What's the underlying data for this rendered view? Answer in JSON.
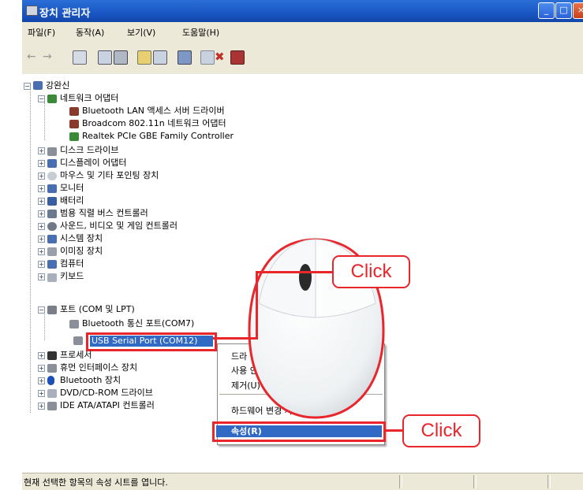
{
  "window": {
    "title": "장치 관리자",
    "controls": [
      "minimize",
      "maximize",
      "close"
    ]
  },
  "menu": [
    "파일(F)",
    "동작(A)",
    "보기(V)",
    "도움말(H)"
  ],
  "toolbar": {
    "icons": [
      "back-icon",
      "forward-icon",
      "view-icon",
      "properties-icon",
      "print-icon",
      "help-icon",
      "scan-icon",
      "update-driver-icon",
      "disable-icon",
      "uninstall-icon",
      "stop-icon"
    ]
  },
  "tree": {
    "root": "강완신",
    "network": {
      "label": "네트워크 어댑터",
      "children": [
        "Bluetooth LAN 액세스 서버 드라이버",
        "Broadcom 802.11n 네트워크 어댑터",
        "Realtek PCIe GBE Family Controller"
      ]
    },
    "categories_a": [
      "디스크 드라이브",
      "디스플레이 어댑터",
      "마우스 및 기타 포인팅 장치",
      "모니터",
      "배터리",
      "범용 직렬 버스 컨트롤러",
      "사운드, 비디오 및 게임 컨트롤러",
      "시스템 장치",
      "이미징 장치",
      "컴퓨터",
      "키보드"
    ],
    "ports": {
      "label": "포트 (COM 및 LPT)",
      "children": [
        "Bluetooth 통신 포트(COM7)",
        "USB Serial Port (COM12)"
      ]
    },
    "categories_b": [
      "프로세서",
      "휴먼 인터페이스 장치",
      "Bluetooth 장치",
      "DVD/CD-ROM 드라이브",
      "IDE ATA/ATAPI 컨트롤러"
    ]
  },
  "context_menu": {
    "items": [
      "드라",
      "사용 안",
      "제거(U)",
      "하드웨어 변경 사항 검색(A)",
      "속성(R)"
    ],
    "selected": "속성(R)"
  },
  "callouts": [
    "Click",
    "Click"
  ],
  "status": {
    "text": "현재 선택한 항목의 속성 시트를 엽니다."
  },
  "colors": {
    "titlebar": "#1a56c4",
    "selection": "#316ac5",
    "highlight_red": "#e8262b",
    "chrome": "#ece9d8"
  }
}
